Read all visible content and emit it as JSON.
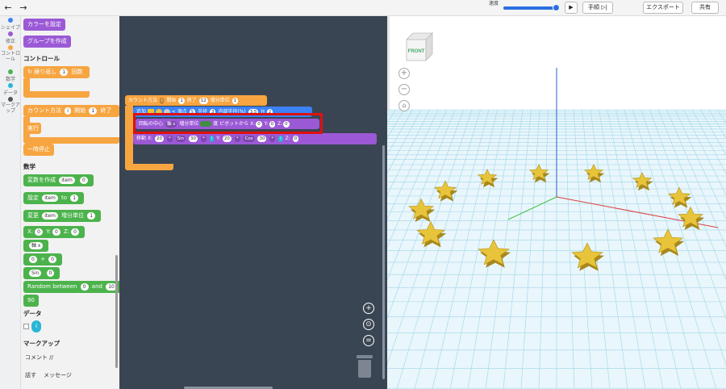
{
  "toolbar": {
    "undo_icon": "undo-arrow-icon",
    "redo_icon": "redo-arrow-icon",
    "speed_label": "速度",
    "play_icon": "▶",
    "step_label": "手順",
    "step_icon": "▷|",
    "export_label": "エクスポート",
    "share_label": "共有"
  },
  "rail": {
    "items": [
      {
        "label": "シェイプ",
        "color": "#3b82f6"
      },
      {
        "label": "修正",
        "color": "#9b59d6"
      },
      {
        "label": "コントロール",
        "color": "#f7a541"
      },
      {
        "label": "数学",
        "color": "#4cb34c"
      },
      {
        "label": "データ",
        "color": "#29b6d6"
      },
      {
        "label": "マークアップ",
        "color": "#555555"
      }
    ]
  },
  "palette": {
    "set_color": "カラーを設定",
    "create_group": "グループを作成",
    "control_heading": "コントロール",
    "repeat": {
      "label": "繰り返し",
      "count": "1",
      "suffix": "回数"
    },
    "count_with": {
      "label": "カウント方法",
      "var": "i",
      "start_label": "開始",
      "start": "1",
      "end_label": "終了"
    },
    "execute": "実行",
    "pause": "一時停止",
    "math_heading": "数学",
    "create_var": {
      "label": "変数を作成",
      "var": "item",
      "value": "0"
    },
    "set_var": {
      "label": "設定",
      "var": "item",
      "to": "to",
      "value": "1"
    },
    "change_var": {
      "label": "変更",
      "var": "item",
      "by_label": "増分単位",
      "value": "1"
    },
    "xyz": {
      "x_label": "X:",
      "x": "0",
      "y_label": "Y:",
      "y": "0",
      "z_label": "Z:",
      "z": "0"
    },
    "axis": {
      "value": "軸 x"
    },
    "arith": {
      "a": "0",
      "op": "+",
      "b": "0"
    },
    "trig": {
      "fn": "Sin",
      "value": "0"
    },
    "random": {
      "label": "Random between",
      "min": "0",
      "and": "and",
      "max": "10"
    },
    "number": "90",
    "data_heading": "データ",
    "data_var": "i",
    "markup_heading": "マークアップ",
    "comment": "コメント //",
    "say_label": "話す",
    "say_value": "メッセージ"
  },
  "workspace": {
    "loop": {
      "label": "カウント方法",
      "var": "i",
      "start_label": "開始",
      "start": "1",
      "end_label": "終了",
      "end": "12",
      "step_label": "増分単位",
      "step": "1"
    },
    "add": {
      "label": "追加",
      "points_label": "頂点",
      "points": "5",
      "radius_label": "半径",
      "radius": "3",
      "inner_label": "内部半径(%)",
      "inner": "3.5",
      "h_label": "H",
      "h": "2"
    },
    "rotate": {
      "label": "回転の中心",
      "axis": "軸 x",
      "by_label": "増分単位",
      "deg_label": "度",
      "pivot_label": "ピボットから",
      "x_label": "X:",
      "x": "0",
      "y_label": "Y:",
      "y": "0",
      "z_label": "Z:",
      "z": "0"
    },
    "move": {
      "label": "移動",
      "x_label": "X:",
      "x": "20",
      "op1": "*",
      "fn1": "Sin",
      "v1": "30",
      "op2": "*",
      "var1": "i",
      "y_label": "Y:",
      "y": "20",
      "op3": "*",
      "fn2": "Cos",
      "v2": "30",
      "op4": "*",
      "var2": "i",
      "z_label": "Z:",
      "z": "0"
    }
  },
  "viewport": {
    "cube_label": "FRONT",
    "zoom_in": "+",
    "zoom_out": "−",
    "home": "⌂"
  },
  "colors": {
    "workspace_bg": "#3a4553",
    "purple": "#9b59d6",
    "orange": "#f7a541",
    "green": "#4cb34c",
    "grid": "#9fd6ea",
    "star": "#e8c43a",
    "highlight": "#e01010"
  }
}
